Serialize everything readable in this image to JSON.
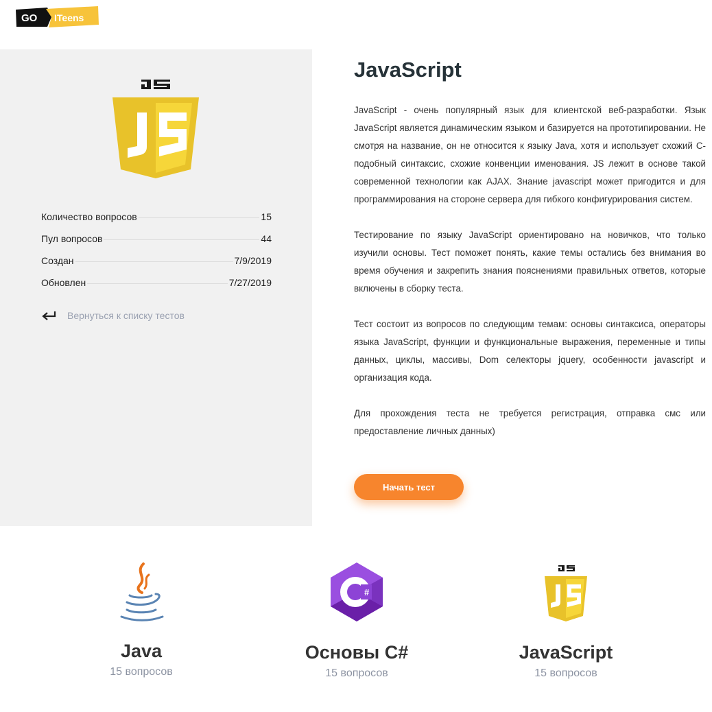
{
  "logo": {
    "part1": "GO",
    "part2": "ITeens"
  },
  "stats": [
    {
      "label": "Количество вопросов",
      "value": "15"
    },
    {
      "label": "Пул вопросов",
      "value": "44"
    },
    {
      "label": "Создан",
      "value": "7/9/2019"
    },
    {
      "label": "Обновлен",
      "value": "7/27/2019"
    }
  ],
  "back_link": {
    "label": "Вернуться к списку тестов",
    "icon": "return-arrow-icon"
  },
  "title": "JavaScript",
  "description": [
    "JavaScript - очень популярный язык для клиентской веб-разработки. Язык JavaScript является динамическим языком и базируется на прототипировании. Не смотря на название, он не относится к языку Java, хотя и использует схожий С-подобный синтаксис, схожие конвенции именования. JS лежит в основе такой современной технологии как AJAX. Знание javascript может пригодится и для программирования на стороне сервера для гибкого конфигурирования систем.",
    "Тестирование по языку JavaScript ориентировано на новичков, что только изучили основы. Тест поможет понять, какие темы остались без внимания во время обучения и закрепить знания пояснениями правильных ответов, которые включены в сборку теста.",
    "Тест состоит из вопросов по следующим темам: основы синтаксиса, операторы языка JavaScript, функции и функциональные выражения, переменные и типы данных, циклы, массивы, Dom селекторы jquery, особенности javascript и организация кода.",
    "Для прохождения теста не требуется регистрация, отправка смс или предоставление личных данных)"
  ],
  "start_button": "Начать тест",
  "cards": [
    {
      "title": "Java",
      "count": "15 вопросов",
      "icon": "java-icon"
    },
    {
      "title": "Основы C#",
      "count": "15 вопросов",
      "icon": "csharp-icon"
    },
    {
      "title": "JavaScript",
      "count": "15 вопросов",
      "icon": "javascript-icon"
    }
  ],
  "colors": {
    "accent": "#f7852d",
    "js_yellow": "#f0cc28",
    "panel_bg": "#f1f1f1",
    "csharp": "#7b3fc4"
  }
}
